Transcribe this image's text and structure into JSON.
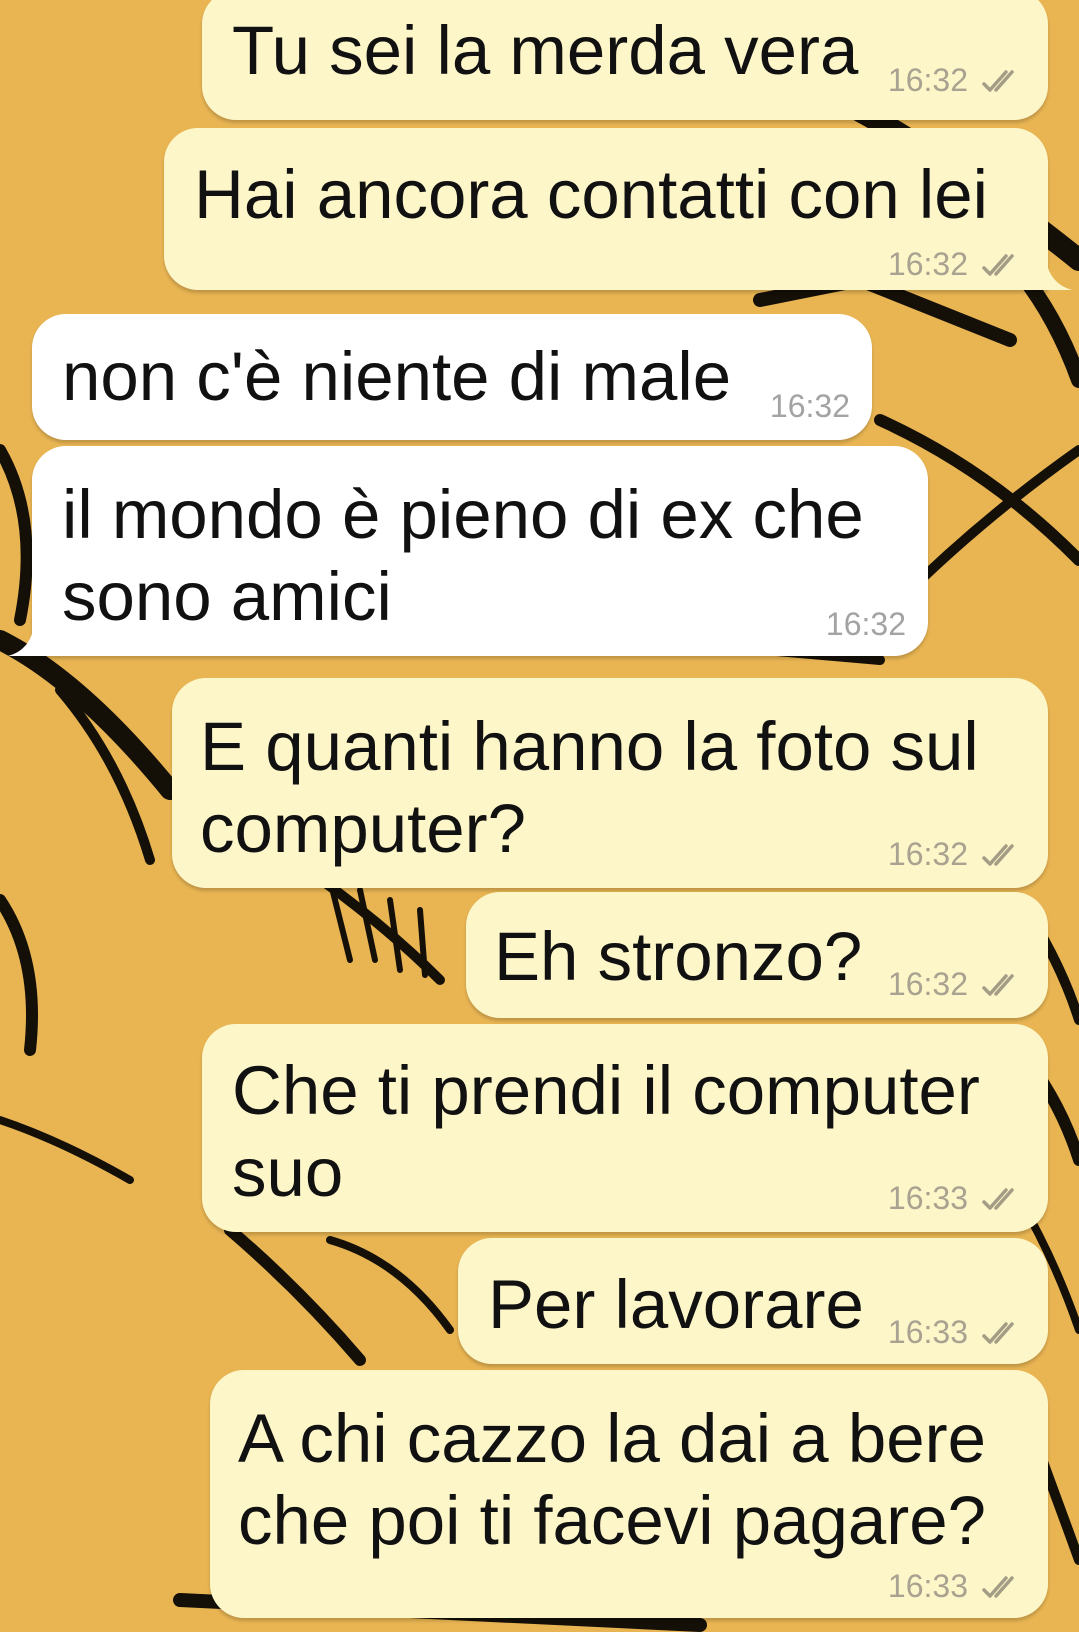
{
  "messages": [
    {
      "direction": "out",
      "text": "Tu sei la merda vera",
      "time": "16:32",
      "status_icon": "double-check-icon"
    },
    {
      "direction": "out",
      "text": "Hai ancora contatti con lei",
      "time": "16:32",
      "status_icon": "double-check-icon"
    },
    {
      "direction": "in",
      "text": "non c'è niente di male",
      "time": "16:32"
    },
    {
      "direction": "in",
      "text": "il mondo è pieno di ex che\nsono amici",
      "time": "16:32"
    },
    {
      "direction": "out",
      "text": "E quanti hanno la foto sul\ncomputer?",
      "time": "16:32",
      "status_icon": "double-check-icon"
    },
    {
      "direction": "out",
      "text": "Eh stronzo?",
      "time": "16:32",
      "status_icon": "double-check-icon"
    },
    {
      "direction": "out",
      "text": "Che ti prendi il computer\nsuo",
      "time": "16:33",
      "status_icon": "double-check-icon"
    },
    {
      "direction": "out",
      "text": "Per lavorare",
      "time": "16:33",
      "status_icon": "double-check-icon"
    },
    {
      "direction": "out",
      "text": "A chi cazzo la dai a bere\nche poi ti facevi pagare?",
      "time": "16:33",
      "status_icon": "double-check-icon"
    }
  ],
  "colors": {
    "wallpaper": "#e9b553",
    "outgoing_bubble": "#fdf6c9",
    "incoming_bubble": "#ffffff",
    "ticks": "#a49d85"
  }
}
